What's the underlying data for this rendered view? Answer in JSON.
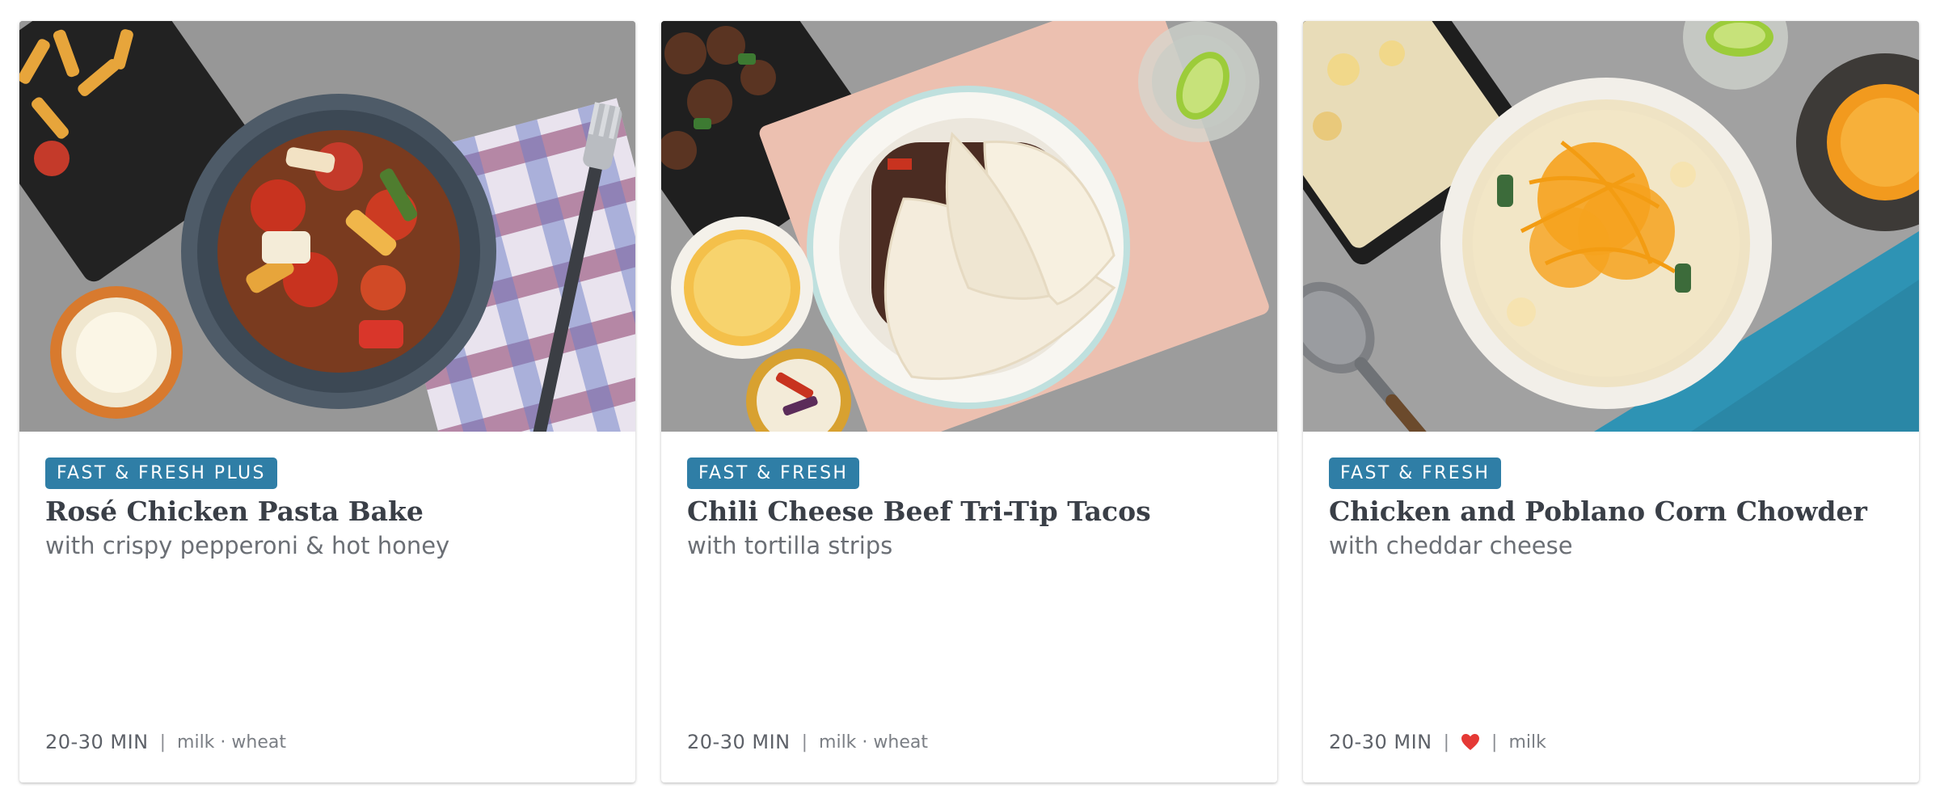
{
  "cards": [
    {
      "badge": "FAST & FRESH PLUS",
      "title": "Rosé Chicken Pasta Bake",
      "subtitle": "with crispy pepperoni & hot honey",
      "time": "20-30 MIN",
      "separator": "|",
      "allergens": "milk · wheat",
      "favorite": false
    },
    {
      "badge": "FAST & FRESH",
      "title": "Chili Cheese Beef Tri-Tip Tacos",
      "subtitle": "with tortilla strips",
      "time": "20-30 MIN",
      "separator": "|",
      "allergens": "milk · wheat",
      "favorite": false
    },
    {
      "badge": "FAST & FRESH",
      "title": "Chicken and Poblano Corn Chowder",
      "subtitle": "with cheddar cheese",
      "time": "20-30 MIN",
      "separator": "|",
      "allergens": "milk",
      "favorite": true
    }
  ],
  "colors": {
    "badge_bg": "#2f7ea6",
    "title": "#3a3f47",
    "subtitle": "#6b6f75",
    "heart": "#e53935"
  },
  "icons": {
    "favorite": "heart-icon"
  }
}
